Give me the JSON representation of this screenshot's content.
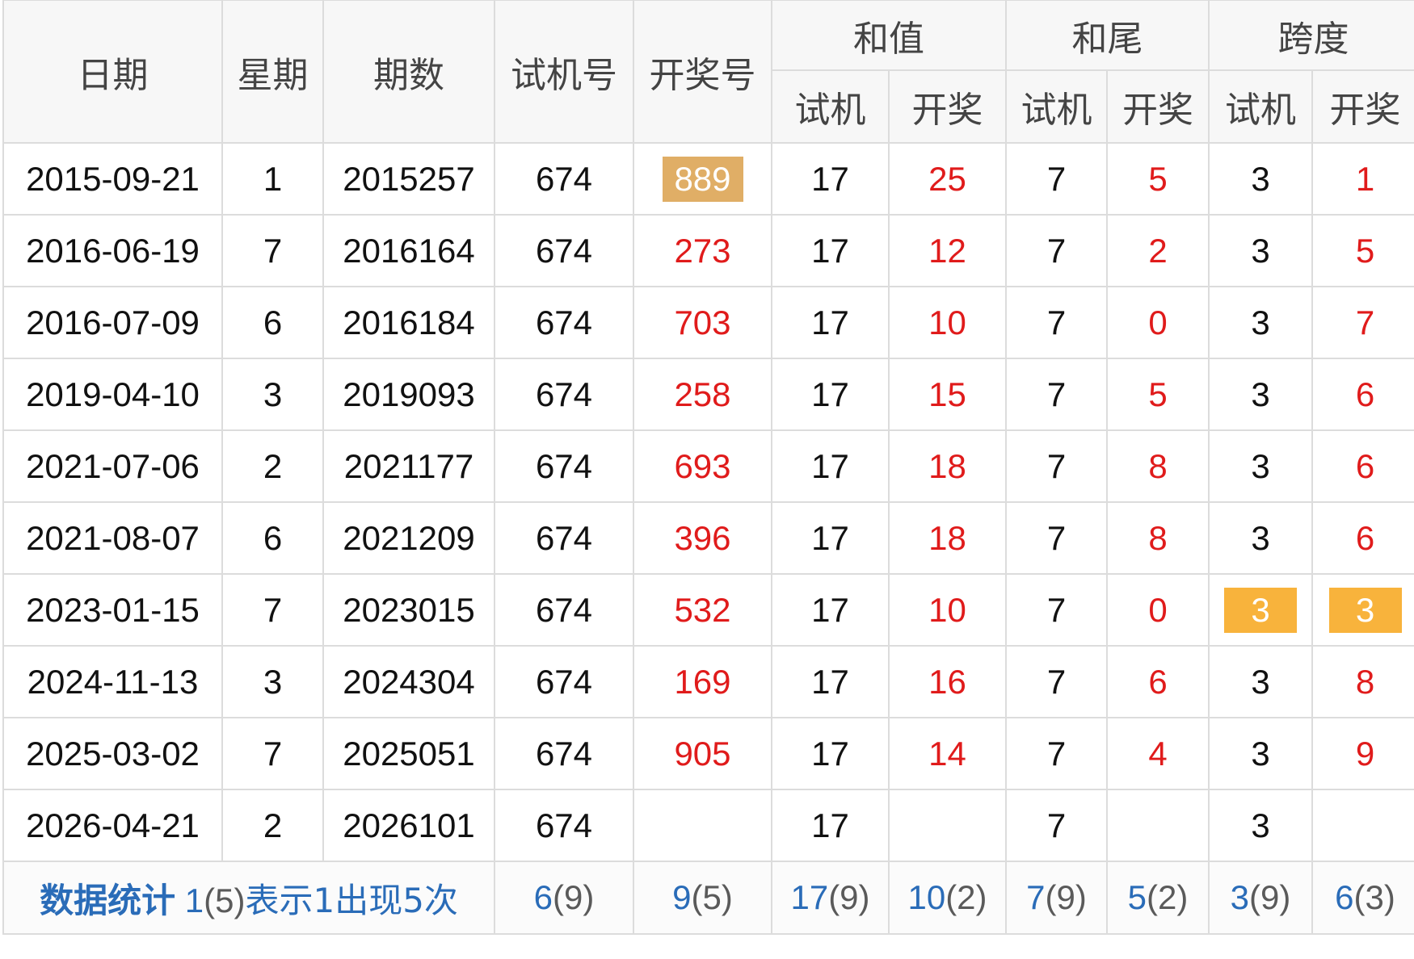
{
  "headers": {
    "date": "日期",
    "weekday": "星期",
    "period": "期数",
    "trial": "试机号",
    "draw": "开奖号",
    "sum": "和值",
    "tail": "和尾",
    "span": "跨度",
    "sub_trial": "试机",
    "sub_draw": "开奖"
  },
  "rows": [
    {
      "date": "2015-09-21",
      "weekday": "1",
      "period": "2015257",
      "trial": "674",
      "draw": "889",
      "sum_trial": "17",
      "sum_draw": "25",
      "tail_trial": "7",
      "tail_draw": "5",
      "span_trial": "3",
      "span_draw": "1"
    },
    {
      "date": "2016-06-19",
      "weekday": "7",
      "period": "2016164",
      "trial": "674",
      "draw": "273",
      "sum_trial": "17",
      "sum_draw": "12",
      "tail_trial": "7",
      "tail_draw": "2",
      "span_trial": "3",
      "span_draw": "5"
    },
    {
      "date": "2016-07-09",
      "weekday": "6",
      "period": "2016184",
      "trial": "674",
      "draw": "703",
      "sum_trial": "17",
      "sum_draw": "10",
      "tail_trial": "7",
      "tail_draw": "0",
      "span_trial": "3",
      "span_draw": "7"
    },
    {
      "date": "2019-04-10",
      "weekday": "3",
      "period": "2019093",
      "trial": "674",
      "draw": "258",
      "sum_trial": "17",
      "sum_draw": "15",
      "tail_trial": "7",
      "tail_draw": "5",
      "span_trial": "3",
      "span_draw": "6"
    },
    {
      "date": "2021-07-06",
      "weekday": "2",
      "period": "2021177",
      "trial": "674",
      "draw": "693",
      "sum_trial": "17",
      "sum_draw": "18",
      "tail_trial": "7",
      "tail_draw": "8",
      "span_trial": "3",
      "span_draw": "6"
    },
    {
      "date": "2021-08-07",
      "weekday": "6",
      "period": "2021209",
      "trial": "674",
      "draw": "396",
      "sum_trial": "17",
      "sum_draw": "18",
      "tail_trial": "7",
      "tail_draw": "8",
      "span_trial": "3",
      "span_draw": "6"
    },
    {
      "date": "2023-01-15",
      "weekday": "7",
      "period": "2023015",
      "trial": "674",
      "draw": "532",
      "sum_trial": "17",
      "sum_draw": "10",
      "tail_trial": "7",
      "tail_draw": "0",
      "span_trial": "3",
      "span_draw": "3"
    },
    {
      "date": "2024-11-13",
      "weekday": "3",
      "period": "2024304",
      "trial": "674",
      "draw": "169",
      "sum_trial": "17",
      "sum_draw": "16",
      "tail_trial": "7",
      "tail_draw": "6",
      "span_trial": "3",
      "span_draw": "8"
    },
    {
      "date": "2025-03-02",
      "weekday": "7",
      "period": "2025051",
      "trial": "674",
      "draw": "905",
      "sum_trial": "17",
      "sum_draw": "14",
      "tail_trial": "7",
      "tail_draw": "4",
      "span_trial": "3",
      "span_draw": "9"
    },
    {
      "date": "2026-04-21",
      "weekday": "2",
      "period": "2026101",
      "trial": "674",
      "draw": "",
      "sum_trial": "17",
      "sum_draw": "",
      "tail_trial": "7",
      "tail_draw": "",
      "span_trial": "3",
      "span_draw": ""
    }
  ],
  "footer": {
    "label": "数据统计",
    "note_value": "1",
    "note_count": "(5)",
    "note_text": "表示1出现5次",
    "stats": [
      {
        "value": "6",
        "count": "(9)"
      },
      {
        "value": "9",
        "count": "(5)"
      },
      {
        "value": "17",
        "count": "(9)"
      },
      {
        "value": "10",
        "count": "(2)"
      },
      {
        "value": "7",
        "count": "(9)"
      },
      {
        "value": "5",
        "count": "(2)"
      },
      {
        "value": "3",
        "count": "(9)"
      },
      {
        "value": "6",
        "count": "(3)"
      }
    ]
  },
  "colors": {
    "draw_text": "#e01b1b",
    "highlight_tan": "#e0ae66",
    "highlight_orange": "#f8b33c",
    "stat_blue": "#2a6cb8",
    "header_bg": "#f7f7f7"
  }
}
